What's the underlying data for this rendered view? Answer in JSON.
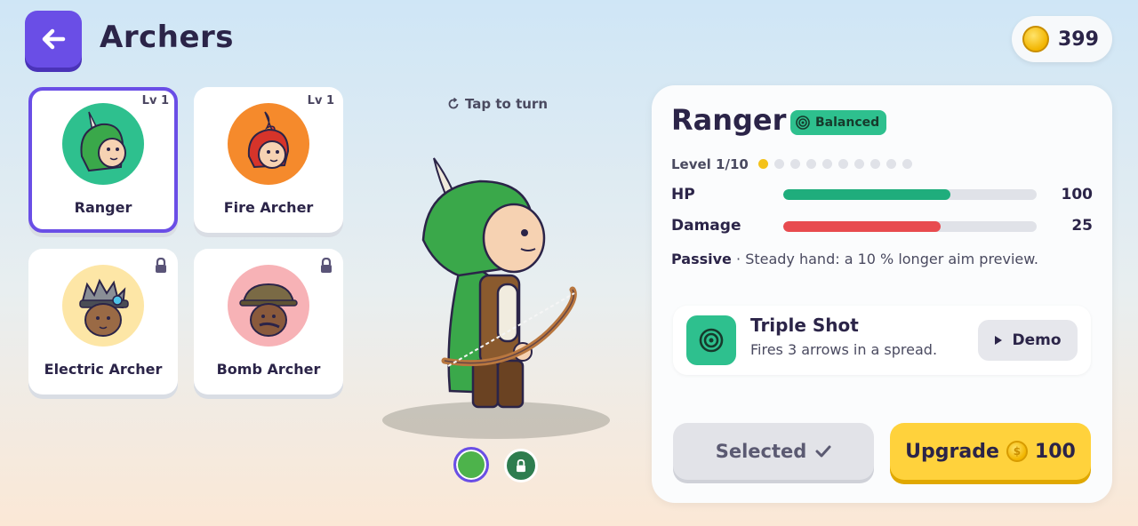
{
  "header": {
    "title": "Archers",
    "coins": "399"
  },
  "roster": [
    {
      "name": "Ranger",
      "level": "Lv 1",
      "bg": "#2ec08e",
      "locked": false,
      "selected": true
    },
    {
      "name": "Fire Archer",
      "level": "Lv 1",
      "bg": "#f58a2c",
      "locked": false,
      "selected": false
    },
    {
      "name": "Electric Archer",
      "level": "",
      "bg": "#fde6a6",
      "locked": true,
      "selected": false
    },
    {
      "name": "Bomb Archer",
      "level": "",
      "bg": "#f7b2b6",
      "locked": true,
      "selected": false
    }
  ],
  "preview": {
    "tap_hint": "Tap to turn",
    "skins": [
      "#4db34b",
      "#2e7d4f"
    ]
  },
  "detail": {
    "name": "Ranger",
    "tag": "Balanced",
    "level_label": "Level 1/10",
    "level": 1,
    "level_max": 10,
    "stats": [
      {
        "label": "HP",
        "value": "100",
        "fill_fraction": 0.66,
        "color": "#1fad7c"
      },
      {
        "label": "Damage",
        "value": "25",
        "fill_fraction": 0.62,
        "color": "#e84b4f"
      }
    ],
    "passive_label": "Passive",
    "passive_text": "Steady hand: a 10 % longer aim preview.",
    "skill": {
      "name": "Triple Shot",
      "desc": "Fires 3 arrows in a spread.",
      "demo_label": "Demo"
    },
    "selected_label": "Selected",
    "upgrade_label": "Upgrade",
    "upgrade_cost": "100"
  },
  "colors": {
    "accent": "#6a4ee6",
    "teal": "#2ec08e",
    "gold": "#ffd23c"
  }
}
